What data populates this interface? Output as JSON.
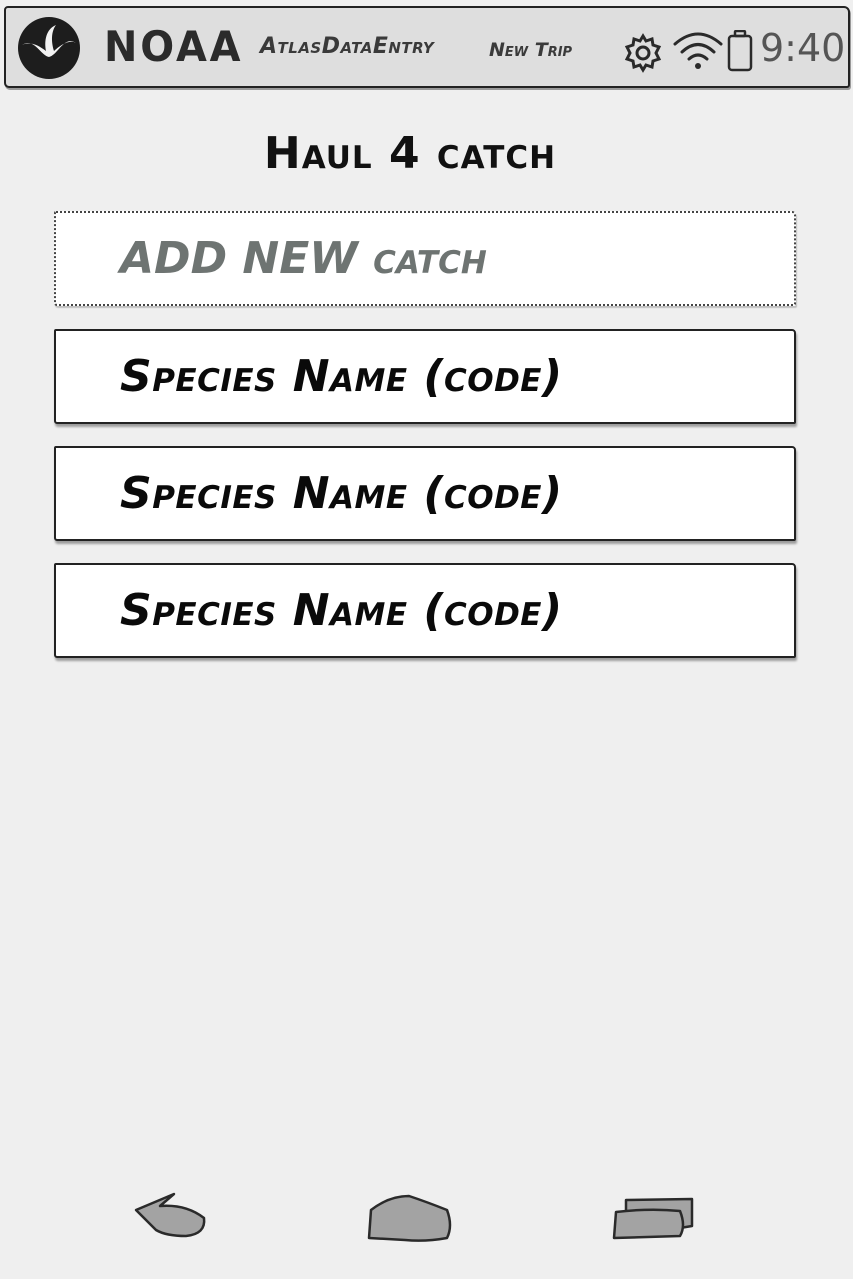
{
  "status_bar": {
    "brand": "NOAA",
    "app_title": "AtlasDataEntry",
    "nav_link": "New Trip",
    "time": "9:40",
    "icons": [
      "noaa-logo-icon",
      "gear-icon",
      "wifi-icon",
      "battery-icon"
    ]
  },
  "screen": {
    "title": "Haul 4 catch"
  },
  "catch_list": {
    "add_label": "ADD NEW catch",
    "items": [
      {
        "label": "Species Name (code)"
      },
      {
        "label": "Species Name (code)"
      },
      {
        "label": "Species Name (code)"
      }
    ]
  },
  "nav_bar": {
    "icons": [
      "back-icon",
      "home-icon",
      "recent-apps-icon"
    ]
  },
  "colors": {
    "background": "#efefef",
    "status_bar": "#dedede",
    "add_text": "#6e7472",
    "nav_icon": "#a3a3a3"
  }
}
